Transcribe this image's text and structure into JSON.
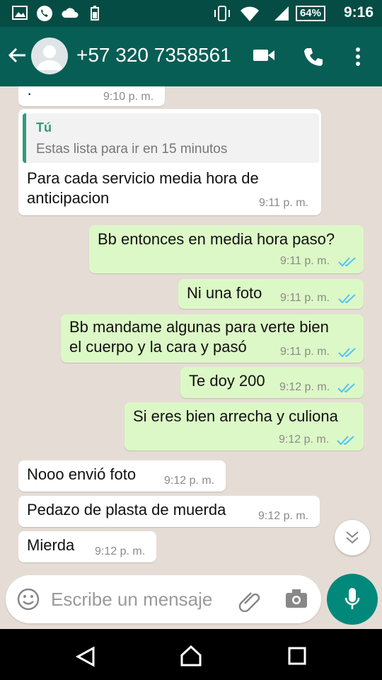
{
  "status_bar": {
    "time": "9:16",
    "battery": "64%"
  },
  "header": {
    "contact": "+57 320 7358561"
  },
  "messages": [
    {
      "dir": "in",
      "text": "·",
      "time": "9:10 p. m."
    },
    {
      "dir": "in",
      "quote_author": "Tú",
      "quote_text": "Estas lista para ir en 15 minutos",
      "line1": "Para cada servicio media hora de",
      "line2": "anticipacion",
      "time": "9:11 p. m."
    },
    {
      "dir": "out",
      "text": "Bb entonces en media hora paso?",
      "time": "9:11 p. m."
    },
    {
      "dir": "out",
      "text": "Ni una foto",
      "time": "9:11 p. m."
    },
    {
      "dir": "out",
      "line1": "Bb mandame algunas para verte bien",
      "line2": "el cuerpo y la cara y pasó",
      "time": "9:11 p. m."
    },
    {
      "dir": "out",
      "text": "Te doy 200",
      "time": "9:12 p. m."
    },
    {
      "dir": "out",
      "text": "Si eres bien arrecha y culiona",
      "time": "9:12 p. m."
    },
    {
      "dir": "in",
      "text": "Nooo envió foto",
      "time": "9:12 p. m."
    },
    {
      "dir": "in",
      "text": "Pedazo de plasta de muerda",
      "time": "9:12 p. m."
    },
    {
      "dir": "in",
      "text": "Mierda",
      "time": "9:12 p. m."
    }
  ],
  "input": {
    "placeholder": "Escribe un mensaje"
  },
  "colors": {
    "header": "#075e54",
    "status_bar": "#054d44",
    "outgoing": "#dcf8c6",
    "incoming": "#ffffff",
    "read_ticks": "#4fc3f7",
    "fab": "#00897b"
  },
  "icons": [
    "image-icon",
    "whatsapp-icon",
    "cloud-icon",
    "battery-saver-icon",
    "vibrate-icon",
    "wifi-icon",
    "signal-icon",
    "back-arrow-icon",
    "avatar-icon",
    "video-call-icon",
    "phone-icon",
    "more-vert-icon",
    "emoji-icon",
    "attach-icon",
    "camera-icon",
    "mic-icon",
    "scroll-down-icon",
    "nav-back-icon",
    "nav-home-icon",
    "nav-recents-icon"
  ]
}
